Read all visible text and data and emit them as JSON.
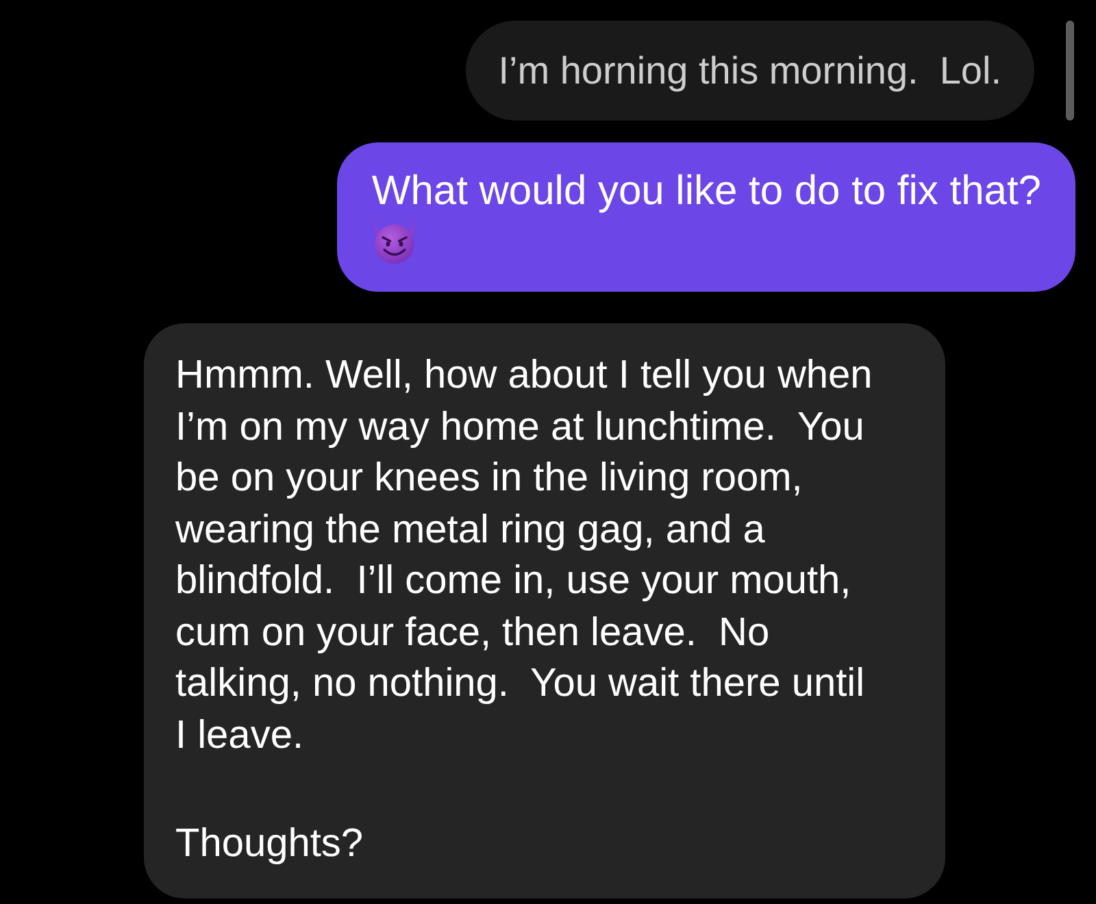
{
  "messages": [
    {
      "kind": "muted",
      "body": [
        {
          "kind": "text",
          "text": "I’m horning this morning.  Lol."
        }
      ]
    },
    {
      "kind": "sent",
      "body": [
        {
          "kind": "text",
          "text": "What would you like to do to fix that?"
        },
        {
          "kind": "emoji"
        }
      ]
    },
    {
      "kind": "received",
      "body": [
        {
          "kind": "text",
          "text": "Hmmm. Well, how about I tell you when I’m on my way home at lunchtime.  You be on your knees in the living room, wearing the metal ring gag, and a blindfold.  I’ll come in, use your mouth, cum on your face, then leave.  No talking, no nothing.  You wait there until I leave."
        },
        {
          "kind": "text",
          "text": "Thoughts?"
        }
      ]
    }
  ]
}
